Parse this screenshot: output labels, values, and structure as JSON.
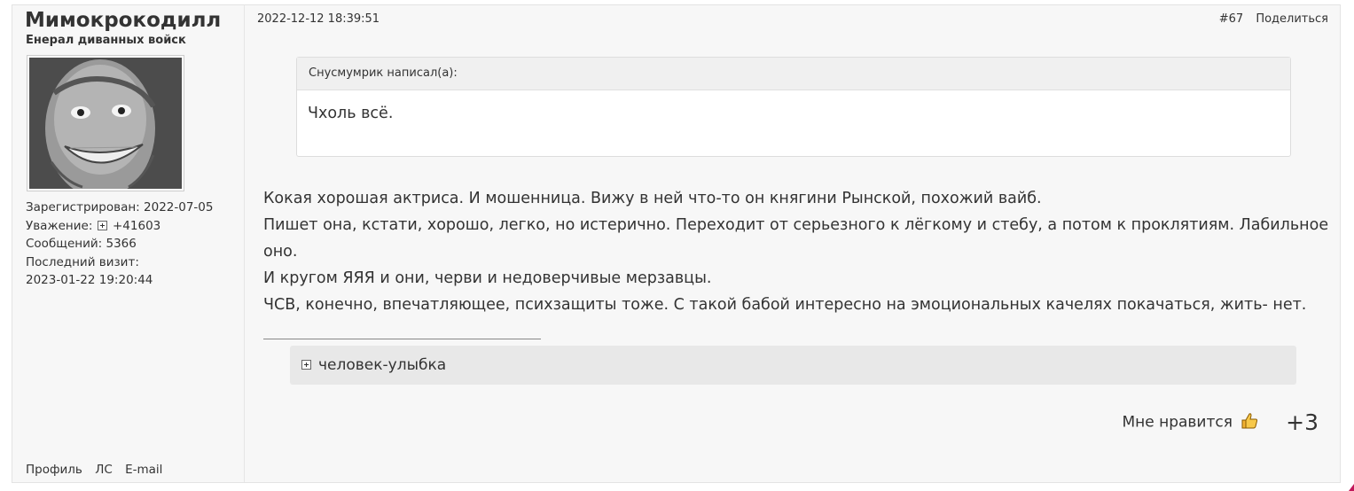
{
  "author": {
    "name": "Мимокрокодилл",
    "title": "Енерал диванных войск",
    "registered": "Зарегистрирован: 2022-07-05",
    "respect_label": "Уважение:",
    "respect_value": "+41603",
    "messages": "Сообщений: 5366",
    "last_visit_label": "Последний визит:",
    "last_visit_value": "2023-01-22 19:20:44",
    "links": [
      "Профиль",
      "ЛС",
      "E-mail"
    ]
  },
  "post": {
    "date": "2022-12-12 18:39:51",
    "number": "#67",
    "share_label": "Поделиться",
    "quote": {
      "header": "Снусмумрик написал(а):",
      "text": "Чхоль всё."
    },
    "lines": [
      "Кокая хорошая актриса. И мошенница. Вижу в ней что-то он княгини Рынской, похожий вайб.",
      "Пишет она, кстати, хорошо, легко, но истерично. Переходит от серьезного к лёгкому и стебу, а потом к проклятиям. Лабильное оно.",
      "И кругом ЯЯЯ и они, черви и недоверчивые мерзавцы.",
      "ЧСВ, конечно, впечатляющее, психзащиты тоже. С такой бабой интересно на эмоциональных качелях покачаться, жить- нет."
    ],
    "spoiler_label": "человек-улыбка",
    "like_label": "Мне нравится",
    "like_count": "+3"
  },
  "colors": {
    "post_bg": "#f7f7f7",
    "quote_header_bg": "#f0f0f0",
    "spoiler_bg": "#e8e8e8",
    "thumb": "#f2b233"
  },
  "icons": [
    "plus-box-icon",
    "thumbs-up-icon"
  ]
}
